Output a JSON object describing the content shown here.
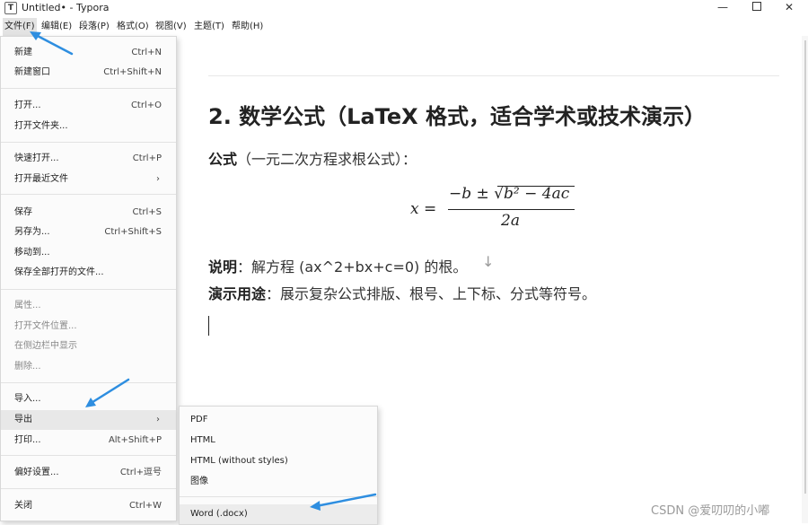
{
  "window": {
    "app_icon": "T",
    "title": "Untitled• - Typora",
    "min": "—",
    "close": "✕"
  },
  "menubar": {
    "file": "文件(F)",
    "edit": "编辑(E)",
    "paragraph": "段落(P)",
    "format": "格式(O)",
    "view": "视图(V)",
    "theme": "主题(T)",
    "help": "帮助(H)"
  },
  "file_menu": {
    "new": {
      "label": "新建",
      "shortcut": "Ctrl+N"
    },
    "new_window": {
      "label": "新建窗口",
      "shortcut": "Ctrl+Shift+N"
    },
    "open": {
      "label": "打开...",
      "shortcut": "Ctrl+O"
    },
    "open_folder": {
      "label": "打开文件夹..."
    },
    "quick_open": {
      "label": "快速打开...",
      "shortcut": "Ctrl+P"
    },
    "open_recent": {
      "label": "打开最近文件",
      "arrow": "›"
    },
    "save": {
      "label": "保存",
      "shortcut": "Ctrl+S"
    },
    "save_as": {
      "label": "另存为...",
      "shortcut": "Ctrl+Shift+S"
    },
    "move_to": {
      "label": "移动到..."
    },
    "save_all": {
      "label": "保存全部打开的文件..."
    },
    "properties": {
      "label": "属性..."
    },
    "open_location": {
      "label": "打开文件位置..."
    },
    "show_sidebar": {
      "label": "在侧边栏中显示"
    },
    "delete": {
      "label": "删除..."
    },
    "import": {
      "label": "导入..."
    },
    "export": {
      "label": "导出",
      "arrow": "›"
    },
    "print": {
      "label": "打印...",
      "shortcut": "Alt+Shift+P"
    },
    "preferences": {
      "label": "偏好设置...",
      "shortcut": "Ctrl+逗号"
    },
    "close": {
      "label": "关闭",
      "shortcut": "Ctrl+W"
    }
  },
  "export_menu": {
    "pdf": "PDF",
    "html": "HTML",
    "html_no_styles": "HTML (without styles)",
    "image": "图像",
    "word": "Word (.docx)"
  },
  "document": {
    "heading": "2. 数学公式（LaTeX 格式，适合学术或技术演示）",
    "formula_label_bold": "公式",
    "formula_label_rest": "（一元二次方程求根公式）：",
    "formula": {
      "lhs": "x",
      "eq": "=",
      "numerator": "−b ± √b² − 4ac",
      "denominator": "2a"
    },
    "desc_bold": "说明",
    "desc_rest": "：解方程 (ax^2+bx+c=0) 的根。",
    "usage_bold": "演示用途",
    "usage_rest": "：展示复杂公式排版、根号、上下标、分式等符号。"
  },
  "watermark": "CSDN @爱叨叨的小嘟",
  "colors": {
    "annotation_arrow": "#2e8ee0",
    "menu_highlight": "#e8e8e8"
  }
}
